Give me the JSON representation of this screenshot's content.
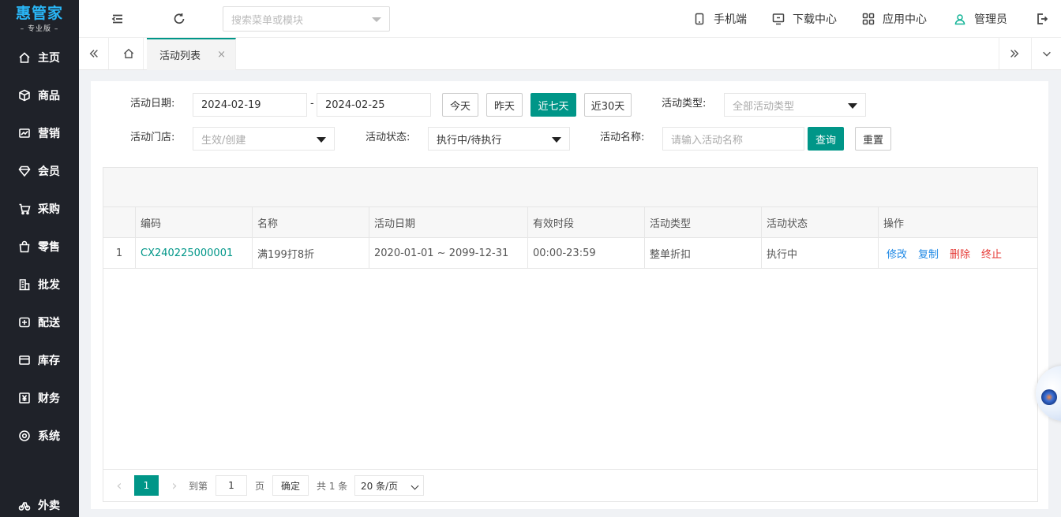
{
  "app": {
    "logo_title": "惠管家",
    "logo_sub": "– 专业版 –"
  },
  "sidebar": {
    "items": [
      {
        "label": "主页",
        "icon": "home-icon"
      },
      {
        "label": "商品",
        "icon": "box-icon"
      },
      {
        "label": "营销",
        "icon": "chart-icon"
      },
      {
        "label": "会员",
        "icon": "diamond-icon"
      },
      {
        "label": "采购",
        "icon": "cart-icon"
      },
      {
        "label": "零售",
        "icon": "bag-icon"
      },
      {
        "label": "批发",
        "icon": "building-icon"
      },
      {
        "label": "配送",
        "icon": "delivery-icon"
      },
      {
        "label": "库存",
        "icon": "inventory-icon"
      },
      {
        "label": "财务",
        "icon": "yuan-icon"
      },
      {
        "label": "系统",
        "icon": "settings-icon"
      },
      {
        "label": "外卖",
        "icon": "bike-icon"
      }
    ]
  },
  "header": {
    "search_placeholder": "搜索菜单或模块",
    "mobile": "手机端",
    "download": "下载中心",
    "apps": "应用中心",
    "user": "管理员"
  },
  "tabs": {
    "active": "活动列表",
    "close": "×"
  },
  "filters": {
    "date_label": "活动日期:",
    "date_start": "2024-02-19",
    "date_sep": "-",
    "date_end": "2024-02-25",
    "today": "今天",
    "yesterday": "昨天",
    "last7": "近七天",
    "last30": "近30天",
    "type_label": "活动类型:",
    "type_value": "全部活动类型",
    "store_label": "活动门店:",
    "store_value": "生效/创建",
    "status_label": "活动状态:",
    "status_value": "执行中/待执行",
    "name_label": "活动名称:",
    "name_placeholder": "请输入活动名称",
    "query": "查询",
    "reset": "重置"
  },
  "table": {
    "columns": [
      "",
      "编码",
      "名称",
      "活动日期",
      "有效时段",
      "活动类型",
      "活动状态",
      "操作"
    ],
    "rows": [
      {
        "index": "1",
        "code": "CX240225000001",
        "name": "满199打8折",
        "date": "2020-01-01 ~ 2099-12-31",
        "period": "00:00-23:59",
        "type": "整单折扣",
        "status": "执行中",
        "ops": [
          "修改",
          "复制",
          "删除",
          "终止"
        ]
      }
    ]
  },
  "pager": {
    "prev": "‹",
    "current": "1",
    "next": "›",
    "goto_label": "到第",
    "goto_value": "1",
    "page_unit": "页",
    "confirm": "确定",
    "total": "共 1 条",
    "page_size": "20 条/页"
  }
}
